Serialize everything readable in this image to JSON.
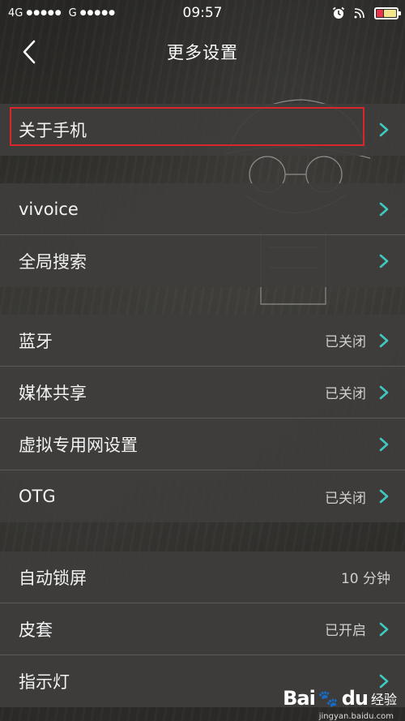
{
  "status_bar": {
    "carrier_left": "4G",
    "signal_dots_1": "●●●●●",
    "carrier_g": "G",
    "signal_dots_2": "●●●●●",
    "time": "09:57",
    "alarm_icon": "alarm-icon",
    "wifi_icon": "wifi-icon",
    "battery_icon": "battery-icon"
  },
  "header": {
    "title": "更多设置",
    "back_icon": "chevron-left-icon"
  },
  "groups": [
    {
      "rows": [
        {
          "label": "关于手机",
          "value": "",
          "highlighted": true
        }
      ]
    },
    {
      "rows": [
        {
          "label": "vivoice",
          "value": ""
        },
        {
          "label": "全局搜索",
          "value": ""
        }
      ]
    },
    {
      "rows": [
        {
          "label": "蓝牙",
          "value": "已关闭"
        },
        {
          "label": "媒体共享",
          "value": "已关闭"
        },
        {
          "label": "虚拟专用网设置",
          "value": ""
        },
        {
          "label": "OTG",
          "value": "已关闭"
        }
      ]
    },
    {
      "rows": [
        {
          "label": "自动锁屏",
          "value": "10 分钟"
        },
        {
          "label": "皮套",
          "value": "已开启"
        },
        {
          "label": "指示灯",
          "value": ""
        }
      ]
    }
  ],
  "colors": {
    "chevron": "#3fc9c0",
    "highlight_border": "#d8262a",
    "row_bg": "#3e3d3c"
  },
  "watermark": {
    "brand": "Bai",
    "brand_du": "du",
    "suffix": "经验",
    "url": "jingyan.baidu.com"
  }
}
